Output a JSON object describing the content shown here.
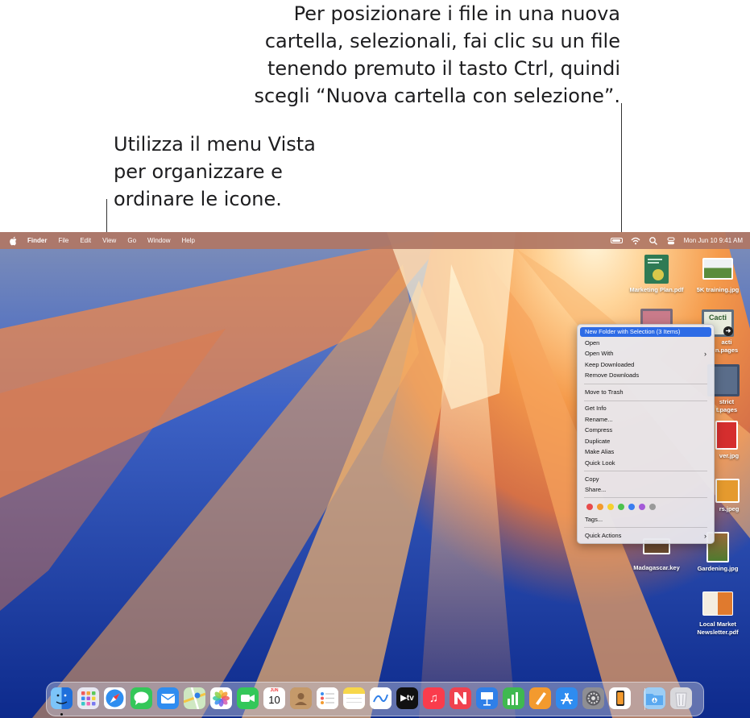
{
  "callouts": {
    "right": [
      "Per posizionare i file in una nuova",
      "cartella, selezionali, fai clic su un file",
      "tenendo premuto il tasto Ctrl, quindi",
      "scegli “Nuova cartella con selezione”."
    ],
    "left": [
      "Utilizza il menu Vista",
      "per organizzare e",
      "ordinare le icone."
    ]
  },
  "menubar": {
    "app": "Finder",
    "items": [
      "File",
      "Edit",
      "View",
      "Go",
      "Window",
      "Help"
    ],
    "clock": "Mon Jun 10  9:41 AM"
  },
  "desktop_icons": [
    {
      "label": "Marketing Plan.pdf"
    },
    {
      "label": "5K training.jpg"
    },
    {
      "label_lines": [
        "acti",
        "n.pages"
      ]
    },
    {
      "label_lines": [
        "strict",
        "t.pages"
      ]
    },
    {
      "label": "ver.jpg"
    },
    {
      "label": "rs.jpeg"
    },
    {
      "label": "Madagascar.key"
    },
    {
      "label": "Gardening.jpg"
    },
    {
      "label_lines": [
        "Local Market",
        "Newsletter.pdf"
      ]
    },
    {
      "thumb_text": "Cacti"
    }
  ],
  "context_menu": {
    "items": [
      {
        "label": "New Folder with Selection (3 Items)",
        "highlighted": true
      },
      {
        "label": "Open"
      },
      {
        "label": "Open With",
        "submenu": true
      },
      {
        "label": "Keep Downloaded"
      },
      {
        "label": "Remove Downloads"
      },
      {
        "label": "Move to Trash"
      },
      {
        "label": "Get Info"
      },
      {
        "label": "Rename..."
      },
      {
        "label": "Compress"
      },
      {
        "label": "Duplicate"
      },
      {
        "label": "Make Alias"
      },
      {
        "label": "Quick Look"
      },
      {
        "label": "Copy"
      },
      {
        "label": "Share..."
      },
      {
        "label": "Tags..."
      },
      {
        "label": "Quick Actions",
        "submenu": true
      }
    ],
    "tag_colors": [
      "#e84b4b",
      "#f39a2e",
      "#f5d02e",
      "#4cc24c",
      "#3a7df0",
      "#a45ad8",
      "#9a9a9a"
    ],
    "submenu_glyph": "›"
  },
  "dock": {
    "apps": [
      {
        "icon": "finder-icon",
        "color": "#2e8cf0"
      },
      {
        "icon": "launchpad-icon",
        "color": "#6b6bd8"
      },
      {
        "icon": "safari-icon",
        "color": "#2f7fe8"
      },
      {
        "icon": "messages-icon",
        "color": "#34c759"
      },
      {
        "icon": "mail-icon",
        "color": "#2e8cf0"
      },
      {
        "icon": "maps-icon",
        "color": "#54b06a"
      },
      {
        "icon": "photos-icon",
        "color": "#ffffff"
      },
      {
        "icon": "facetime-icon",
        "color": "#34c759"
      },
      {
        "icon": "calendar-icon",
        "color": "#ffffff"
      },
      {
        "icon": "contacts-icon",
        "color": "#b8895c"
      },
      {
        "icon": "reminders-icon",
        "color": "#ffffff"
      },
      {
        "icon": "notes-icon",
        "color": "#f7d74a"
      },
      {
        "icon": "freeform-icon",
        "color": "#ffffff"
      },
      {
        "icon": "tv-icon",
        "color": "#111111"
      },
      {
        "icon": "music-icon",
        "color": "#fa3c4c"
      },
      {
        "icon": "news-icon",
        "color": "#f0424f"
      },
      {
        "icon": "keynote-icon",
        "color": "#2f7fe8"
      },
      {
        "icon": "numbers-icon",
        "color": "#3fb950"
      },
      {
        "icon": "pages-icon",
        "color": "#f39a2e"
      },
      {
        "icon": "app-store-icon",
        "color": "#2e8cf0"
      },
      {
        "icon": "system-settings-icon",
        "color": "#8e8e93"
      },
      {
        "icon": "iphone-mirroring-icon",
        "color": "#ffffff"
      },
      {
        "icon": "downloads-folder-icon",
        "color": "#5aa9f0"
      },
      {
        "icon": "trash-icon",
        "color": "#d8d8dc"
      }
    ],
    "calendar": {
      "month": "JUN",
      "day": "10"
    },
    "tv_label": "tv"
  }
}
